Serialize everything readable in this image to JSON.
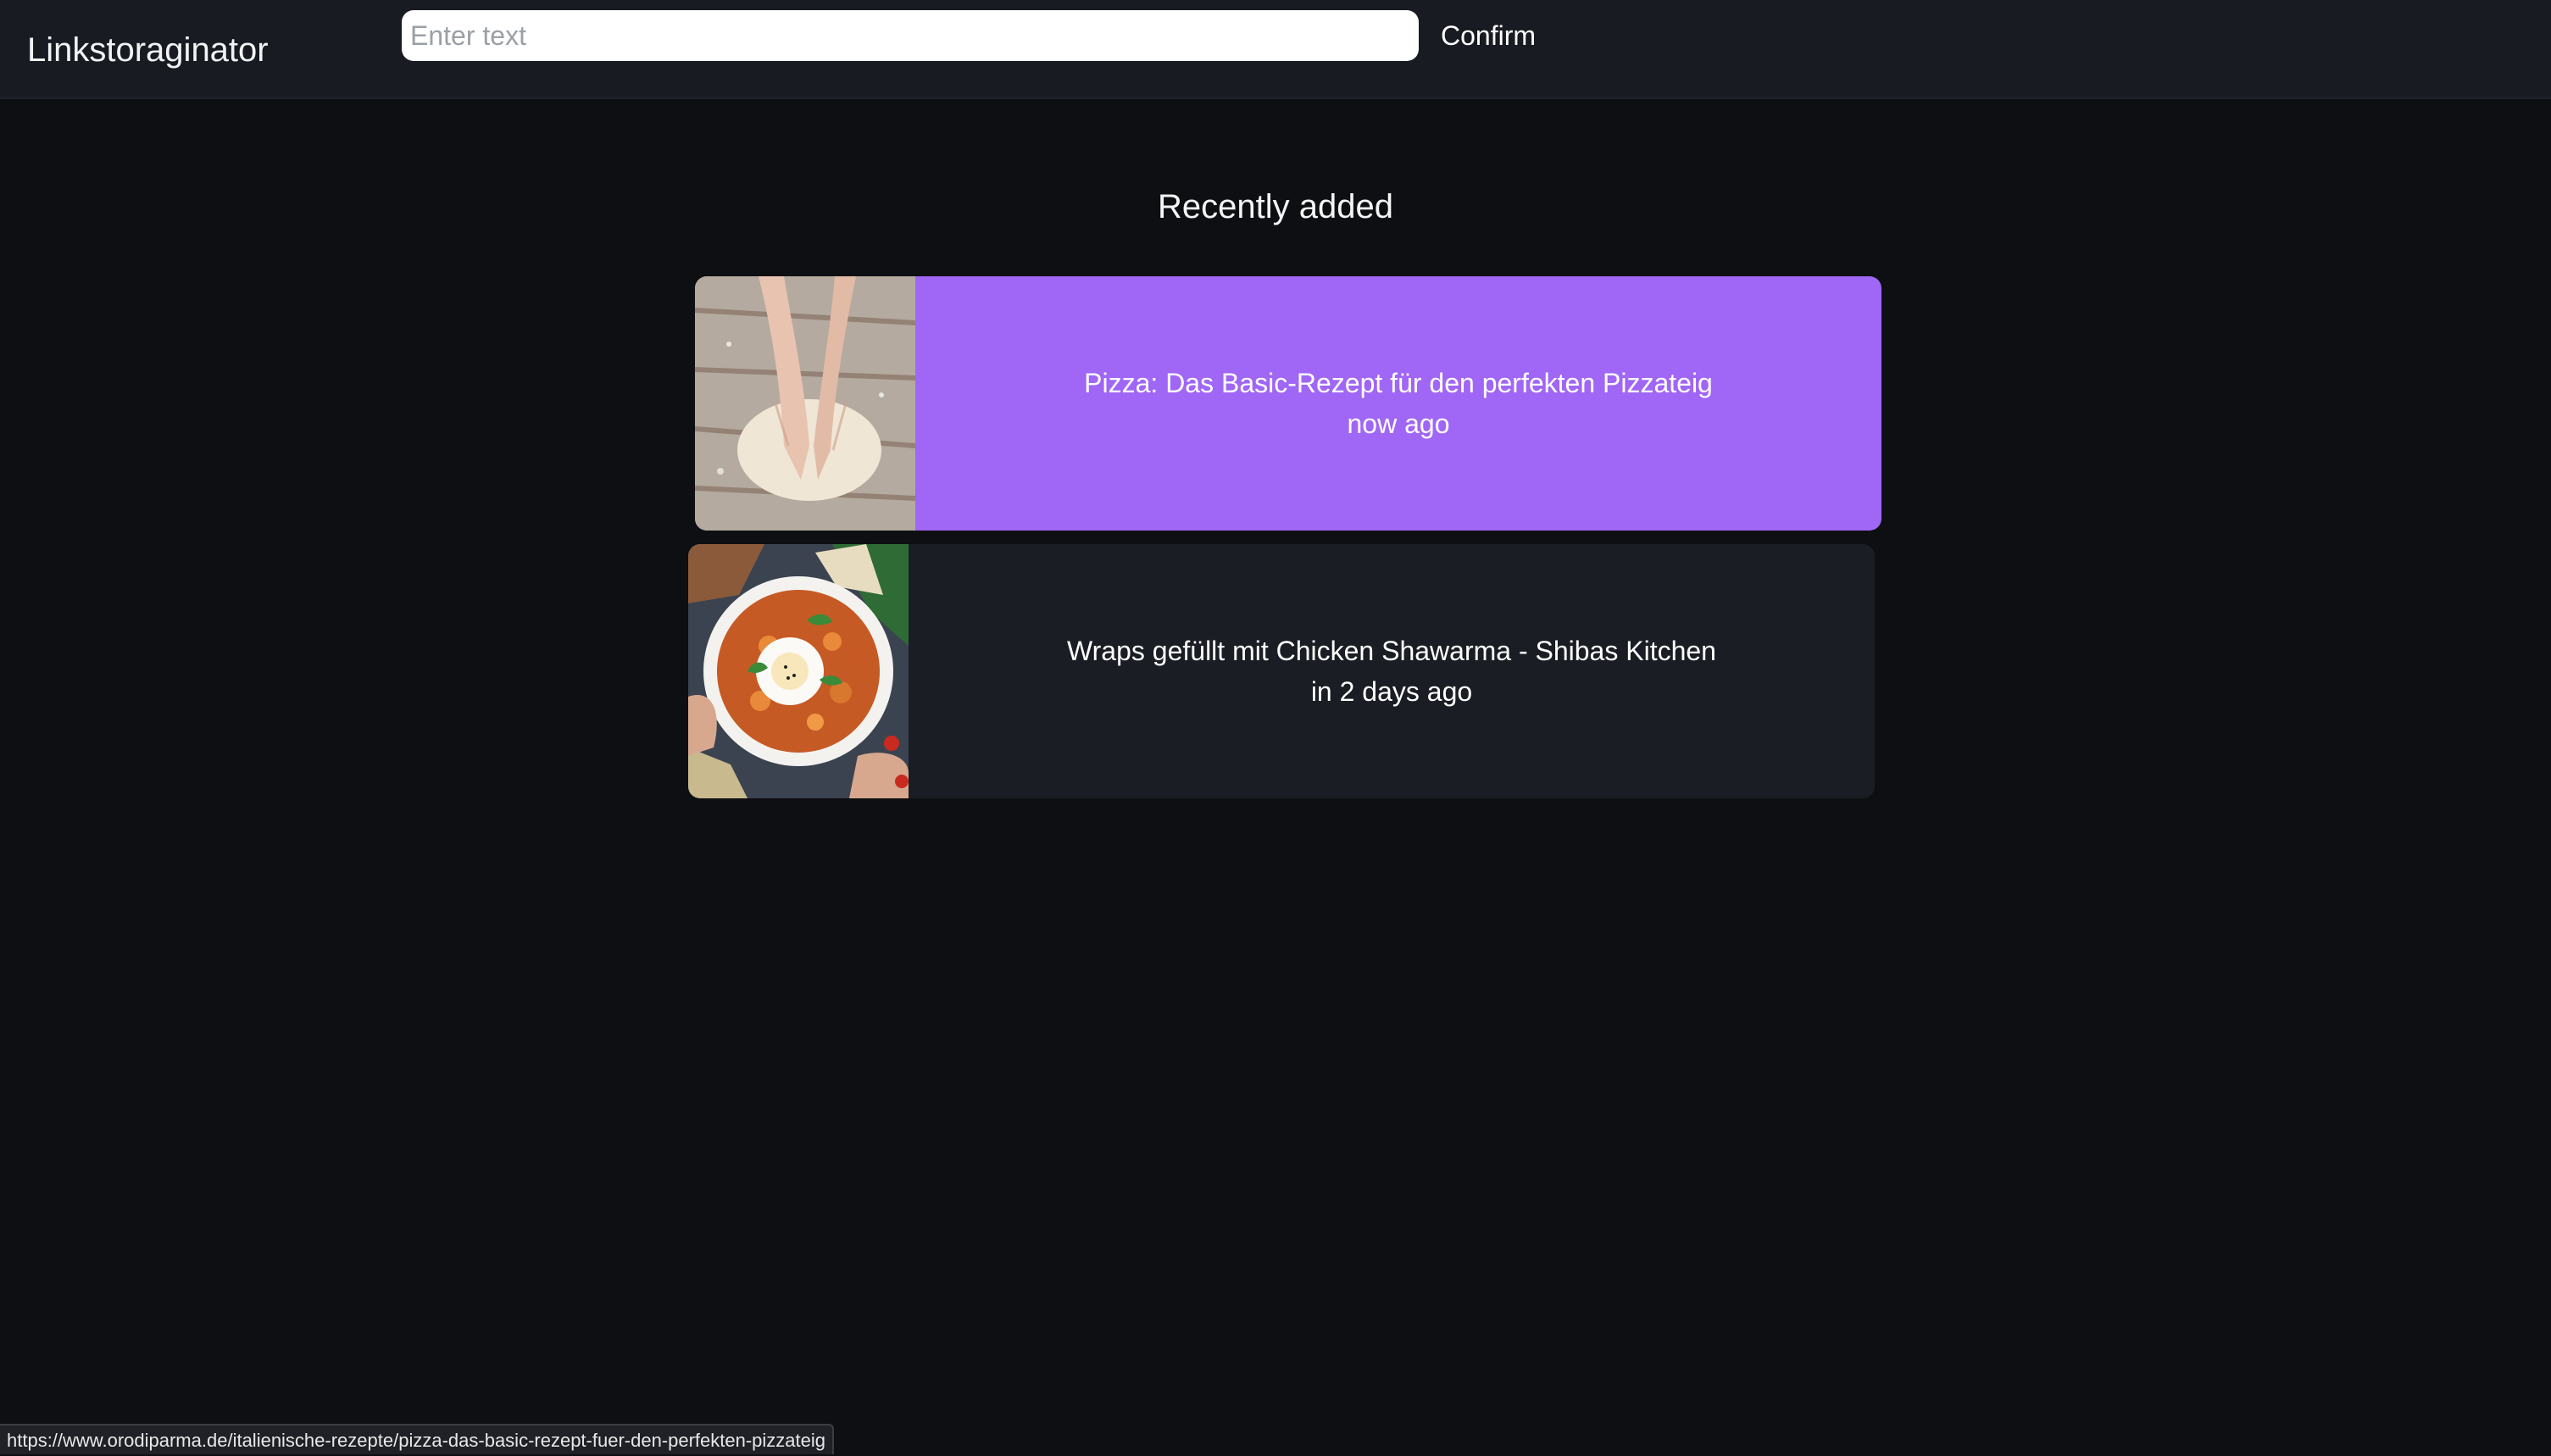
{
  "header": {
    "brand": "Linkstoraginator",
    "search": {
      "placeholder": "Enter text",
      "value": ""
    },
    "confirm_label": "Confirm"
  },
  "main": {
    "section_title": "Recently added",
    "items": [
      {
        "title": "Pizza: Das Basic-Rezept für den perfekten Pizzateig",
        "time": "now ago",
        "thumbnail_icon": "dough-image",
        "highlighted": true,
        "background": "#a066f5"
      },
      {
        "title": "Wraps gefüllt mit Chicken Shawarma - Shibas Kitchen",
        "time": "in 2 days ago",
        "thumbnail_icon": "curry-bowl-image",
        "highlighted": false,
        "background": "#1a1d23"
      }
    ]
  },
  "status_bar": {
    "url": "https://www.orodiparma.de/italienische-rezepte/pizza-das-basic-rezept-fuer-den-perfekten-pizzateig"
  },
  "colors": {
    "page_background": "#0d0f12",
    "header_background": "#181b21",
    "accent": "#a066f5"
  }
}
